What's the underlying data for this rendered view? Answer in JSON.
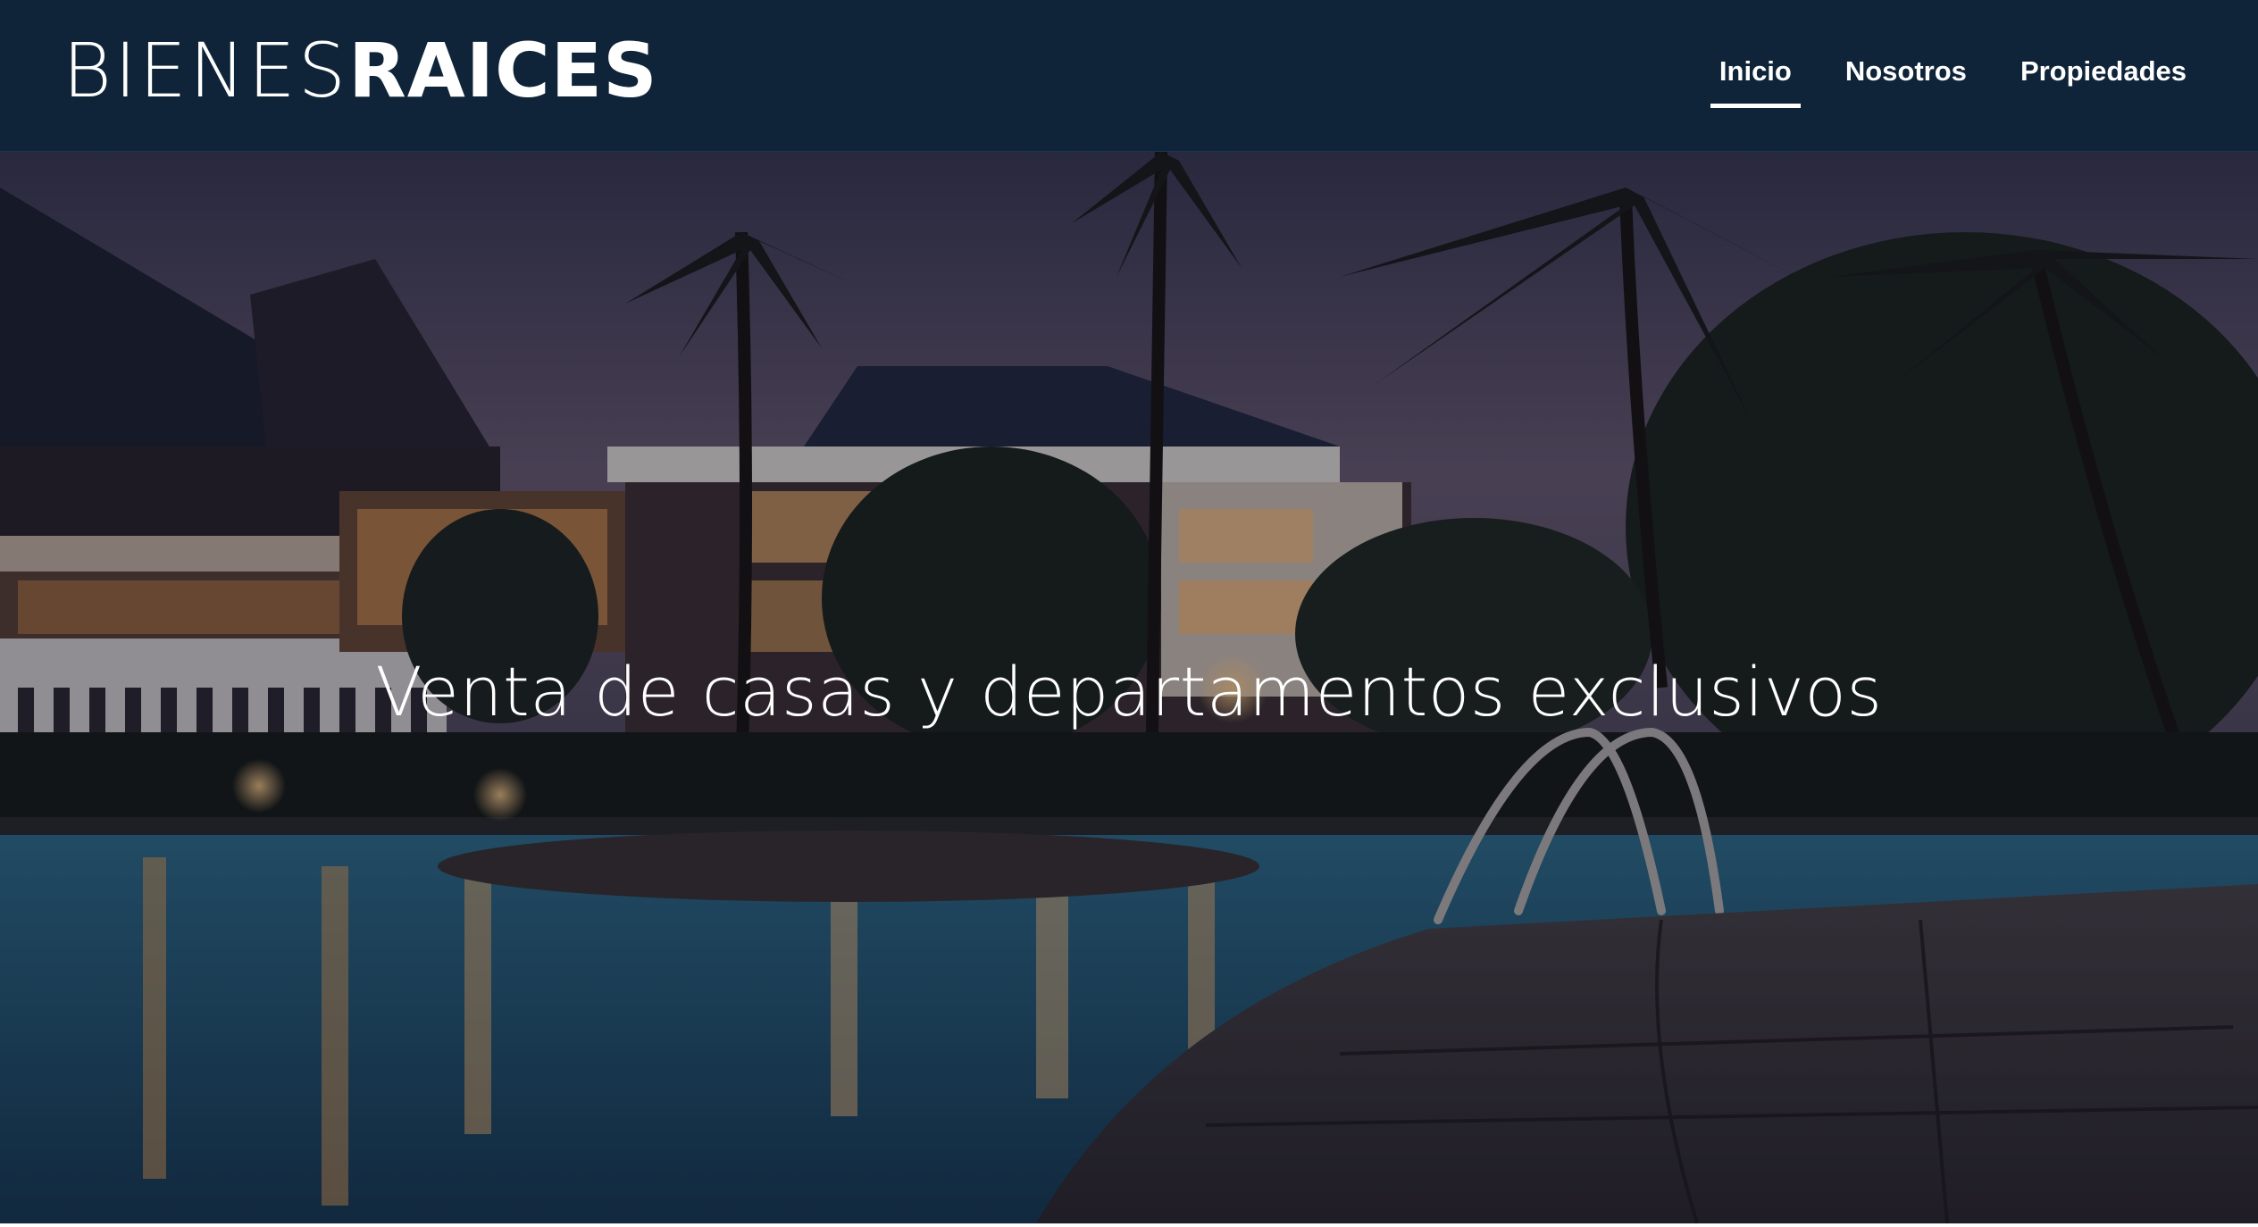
{
  "logo": {
    "part1": "BIENES",
    "part2": "RAICES"
  },
  "nav": {
    "items": [
      {
        "label": "Inicio",
        "active": true
      },
      {
        "label": "Nosotros",
        "active": false
      },
      {
        "label": "Propiedades",
        "active": false
      }
    ]
  },
  "hero": {
    "title": "Venta de casas y departamentos exclusivos"
  },
  "colors": {
    "header_bg": "#0f2438",
    "text": "#ffffff"
  }
}
